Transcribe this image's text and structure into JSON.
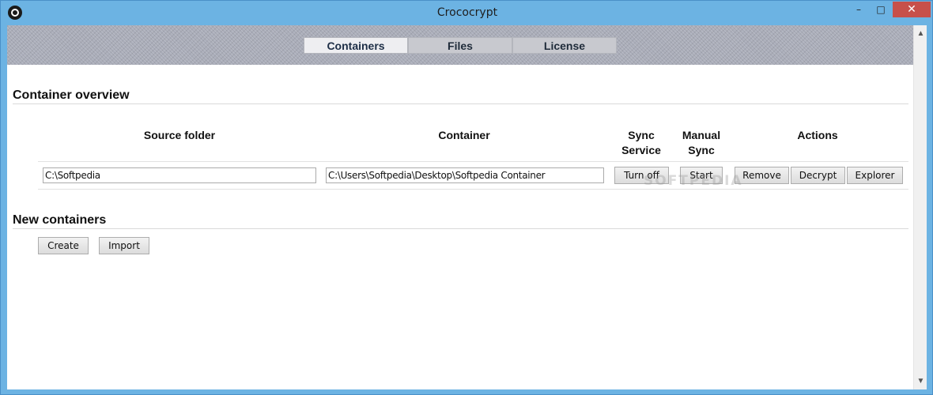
{
  "window": {
    "title": "Crococrypt",
    "controls": {
      "minimize": "–",
      "maximize": "□",
      "close": "✕"
    }
  },
  "tabs": [
    {
      "label": "Containers",
      "active": true
    },
    {
      "label": "Files",
      "active": false
    },
    {
      "label": "License",
      "active": false
    }
  ],
  "overview": {
    "title": "Container overview",
    "columns": {
      "source": "Source folder",
      "container": "Container",
      "sync_line1": "Sync",
      "sync_line2": "Service",
      "manual_line1": "Manual",
      "manual_line2": "Sync",
      "actions": "Actions"
    },
    "rows": [
      {
        "source": "C:\\Softpedia",
        "container": "C:\\Users\\Softpedia\\Desktop\\Softpedia Container",
        "sync_button": "Turn off",
        "manual_button": "Start",
        "remove_button": "Remove",
        "decrypt_button": "Decrypt",
        "explorer_button": "Explorer"
      }
    ]
  },
  "new_containers": {
    "title": "New containers",
    "create_button": "Create",
    "import_button": "Import"
  },
  "watermark": "SOFTPEDIA",
  "colors": {
    "window_frame": "#6cb3e3",
    "close_button": "#c7504a",
    "banner": "#a9acb8",
    "active_tab": "#eeeef1",
    "tab": "#c8c9cf"
  }
}
